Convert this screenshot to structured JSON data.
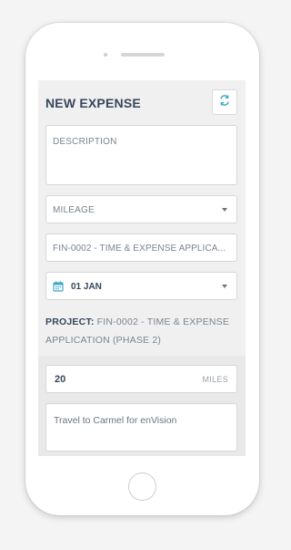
{
  "header": {
    "title": "NEW EXPENSE",
    "sync_icon": "sync-icon",
    "accent": "#3fa9c7"
  },
  "form": {
    "description_placeholder": "DESCRIPTION",
    "expense_type": "MILEAGE",
    "project_select": "FIN-0002 - TIME & EXPENSE APPLICA...",
    "date_icon": "calendar-icon",
    "date": "01 JAN",
    "project_label": "PROJECT:",
    "project_value": "FIN-0002 - TIME & EXPENSE APPLICATION (PHASE 2)",
    "miles_value": "20",
    "miles_unit": "MILES",
    "notes": "Travel to Carmel for enVision"
  }
}
